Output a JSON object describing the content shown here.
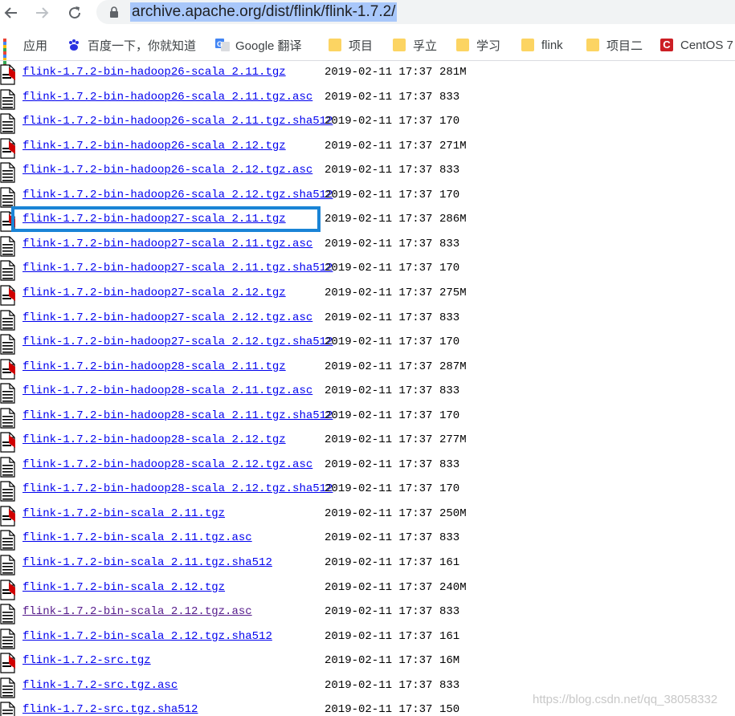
{
  "browser": {
    "url": "archive.apache.org/dist/flink/flink-1.7.2/",
    "bookmarks": [
      {
        "label": "应用",
        "icon": "apps-icon"
      },
      {
        "label": "百度一下，你就知道",
        "icon": "baidu-paw-icon"
      },
      {
        "label": "Google 翻译",
        "icon": "google-translate-icon"
      },
      {
        "label": "项目",
        "icon": "folder-icon"
      },
      {
        "label": "孚立",
        "icon": "folder-icon"
      },
      {
        "label": "学习",
        "icon": "folder-icon"
      },
      {
        "label": "flink",
        "icon": "folder-icon"
      },
      {
        "label": "项目二",
        "icon": "folder-icon"
      },
      {
        "label": "CentOS 7",
        "icon": "centos-icon"
      }
    ]
  },
  "listing": {
    "rows": [
      {
        "name": "flink-1.7.2-bin-hadoop26-scala_2.11.tgz",
        "date": "2019-02-11 17:37",
        "size": "281M",
        "type": "archive"
      },
      {
        "name": "flink-1.7.2-bin-hadoop26-scala_2.11.tgz.asc",
        "date": "2019-02-11 17:37",
        "size": "833",
        "type": "text"
      },
      {
        "name": "flink-1.7.2-bin-hadoop26-scala_2.11.tgz.sha512",
        "date": "2019-02-11 17:37",
        "size": "170",
        "type": "text"
      },
      {
        "name": "flink-1.7.2-bin-hadoop26-scala_2.12.tgz",
        "date": "2019-02-11 17:37",
        "size": "271M",
        "type": "archive"
      },
      {
        "name": "flink-1.7.2-bin-hadoop26-scala_2.12.tgz.asc",
        "date": "2019-02-11 17:37",
        "size": "833",
        "type": "text"
      },
      {
        "name": "flink-1.7.2-bin-hadoop26-scala_2.12.tgz.sha512",
        "date": "2019-02-11 17:37",
        "size": "170",
        "type": "text"
      },
      {
        "name": "flink-1.7.2-bin-hadoop27-scala_2.11.tgz",
        "date": "2019-02-11 17:37",
        "size": "286M",
        "type": "archive"
      },
      {
        "name": "flink-1.7.2-bin-hadoop27-scala_2.11.tgz.asc",
        "date": "2019-02-11 17:37",
        "size": "833",
        "type": "text"
      },
      {
        "name": "flink-1.7.2-bin-hadoop27-scala_2.11.tgz.sha512",
        "date": "2019-02-11 17:37",
        "size": "170",
        "type": "text"
      },
      {
        "name": "flink-1.7.2-bin-hadoop27-scala_2.12.tgz",
        "date": "2019-02-11 17:37",
        "size": "275M",
        "type": "archive"
      },
      {
        "name": "flink-1.7.2-bin-hadoop27-scala_2.12.tgz.asc",
        "date": "2019-02-11 17:37",
        "size": "833",
        "type": "text"
      },
      {
        "name": "flink-1.7.2-bin-hadoop27-scala_2.12.tgz.sha512",
        "date": "2019-02-11 17:37",
        "size": "170",
        "type": "text"
      },
      {
        "name": "flink-1.7.2-bin-hadoop28-scala_2.11.tgz",
        "date": "2019-02-11 17:37",
        "size": "287M",
        "type": "archive"
      },
      {
        "name": "flink-1.7.2-bin-hadoop28-scala_2.11.tgz.asc",
        "date": "2019-02-11 17:37",
        "size": "833",
        "type": "text"
      },
      {
        "name": "flink-1.7.2-bin-hadoop28-scala_2.11.tgz.sha512",
        "date": "2019-02-11 17:37",
        "size": "170",
        "type": "text"
      },
      {
        "name": "flink-1.7.2-bin-hadoop28-scala_2.12.tgz",
        "date": "2019-02-11 17:37",
        "size": "277M",
        "type": "archive"
      },
      {
        "name": "flink-1.7.2-bin-hadoop28-scala_2.12.tgz.asc",
        "date": "2019-02-11 17:37",
        "size": "833",
        "type": "text"
      },
      {
        "name": "flink-1.7.2-bin-hadoop28-scala_2.12.tgz.sha512",
        "date": "2019-02-11 17:37",
        "size": "170",
        "type": "text"
      },
      {
        "name": "flink-1.7.2-bin-scala_2.11.tgz",
        "date": "2019-02-11 17:37",
        "size": "250M",
        "type": "archive"
      },
      {
        "name": "flink-1.7.2-bin-scala_2.11.tgz.asc",
        "date": "2019-02-11 17:37",
        "size": "833",
        "type": "text"
      },
      {
        "name": "flink-1.7.2-bin-scala_2.11.tgz.sha512",
        "date": "2019-02-11 17:37",
        "size": "161",
        "type": "text"
      },
      {
        "name": "flink-1.7.2-bin-scala_2.12.tgz",
        "date": "2019-02-11 17:37",
        "size": "240M",
        "type": "archive"
      },
      {
        "name": "flink-1.7.2-bin-scala_2.12.tgz.asc",
        "date": "2019-02-11 17:37",
        "size": "833",
        "type": "text",
        "visited": true
      },
      {
        "name": "flink-1.7.2-bin-scala_2.12.tgz.sha512",
        "date": "2019-02-11 17:37",
        "size": "161",
        "type": "text"
      },
      {
        "name": "flink-1.7.2-src.tgz",
        "date": "2019-02-11 17:37",
        "size": "16M",
        "type": "archive"
      },
      {
        "name": "flink-1.7.2-src.tgz.asc",
        "date": "2019-02-11 17:37",
        "size": "833",
        "type": "text"
      },
      {
        "name": "flink-1.7.2-src.tgz.sha512",
        "date": "2019-02-11 17:37",
        "size": "150",
        "type": "text"
      }
    ],
    "highlighted_row": "flink-1.7.2-bin-hadoop27-scala_2.11.tgz"
  },
  "watermark": "https://blog.csdn.net/qq_38058332",
  "colors": {
    "link": "#0000ee",
    "visited_link": "#551a8b",
    "highlight_border": "#1a84d6",
    "url_selection": "#a8c7fa",
    "folder": "#fcd462"
  }
}
